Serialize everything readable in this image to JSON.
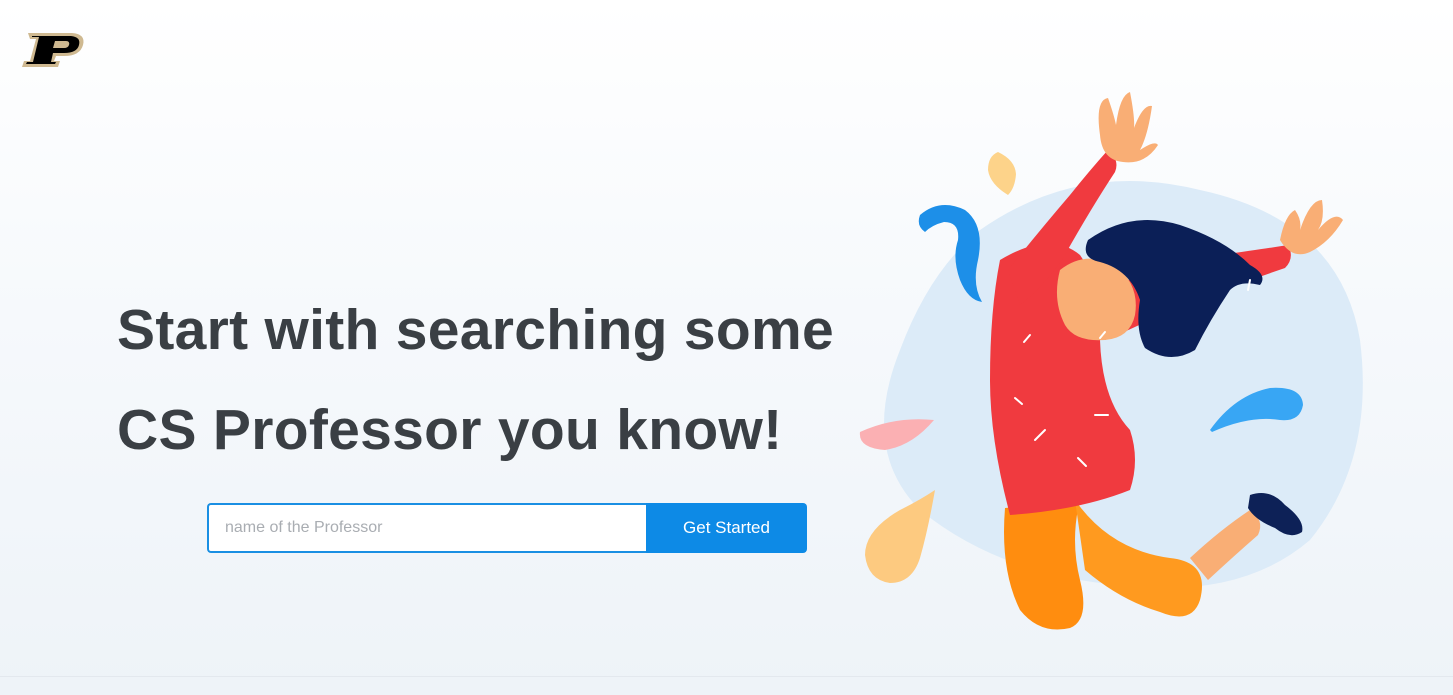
{
  "app": {
    "logo_name": "purdue-p-logo"
  },
  "hero": {
    "headline_line1": "Start with searching some",
    "headline_line2": "CS Professor you know!"
  },
  "search": {
    "placeholder": "name of the Professor",
    "value": "",
    "button_label": "Get Started"
  },
  "colors": {
    "accent": "#0d8ae6",
    "headline": "#3a3f44",
    "logo_gold": "#cfb991",
    "logo_black": "#000000"
  }
}
